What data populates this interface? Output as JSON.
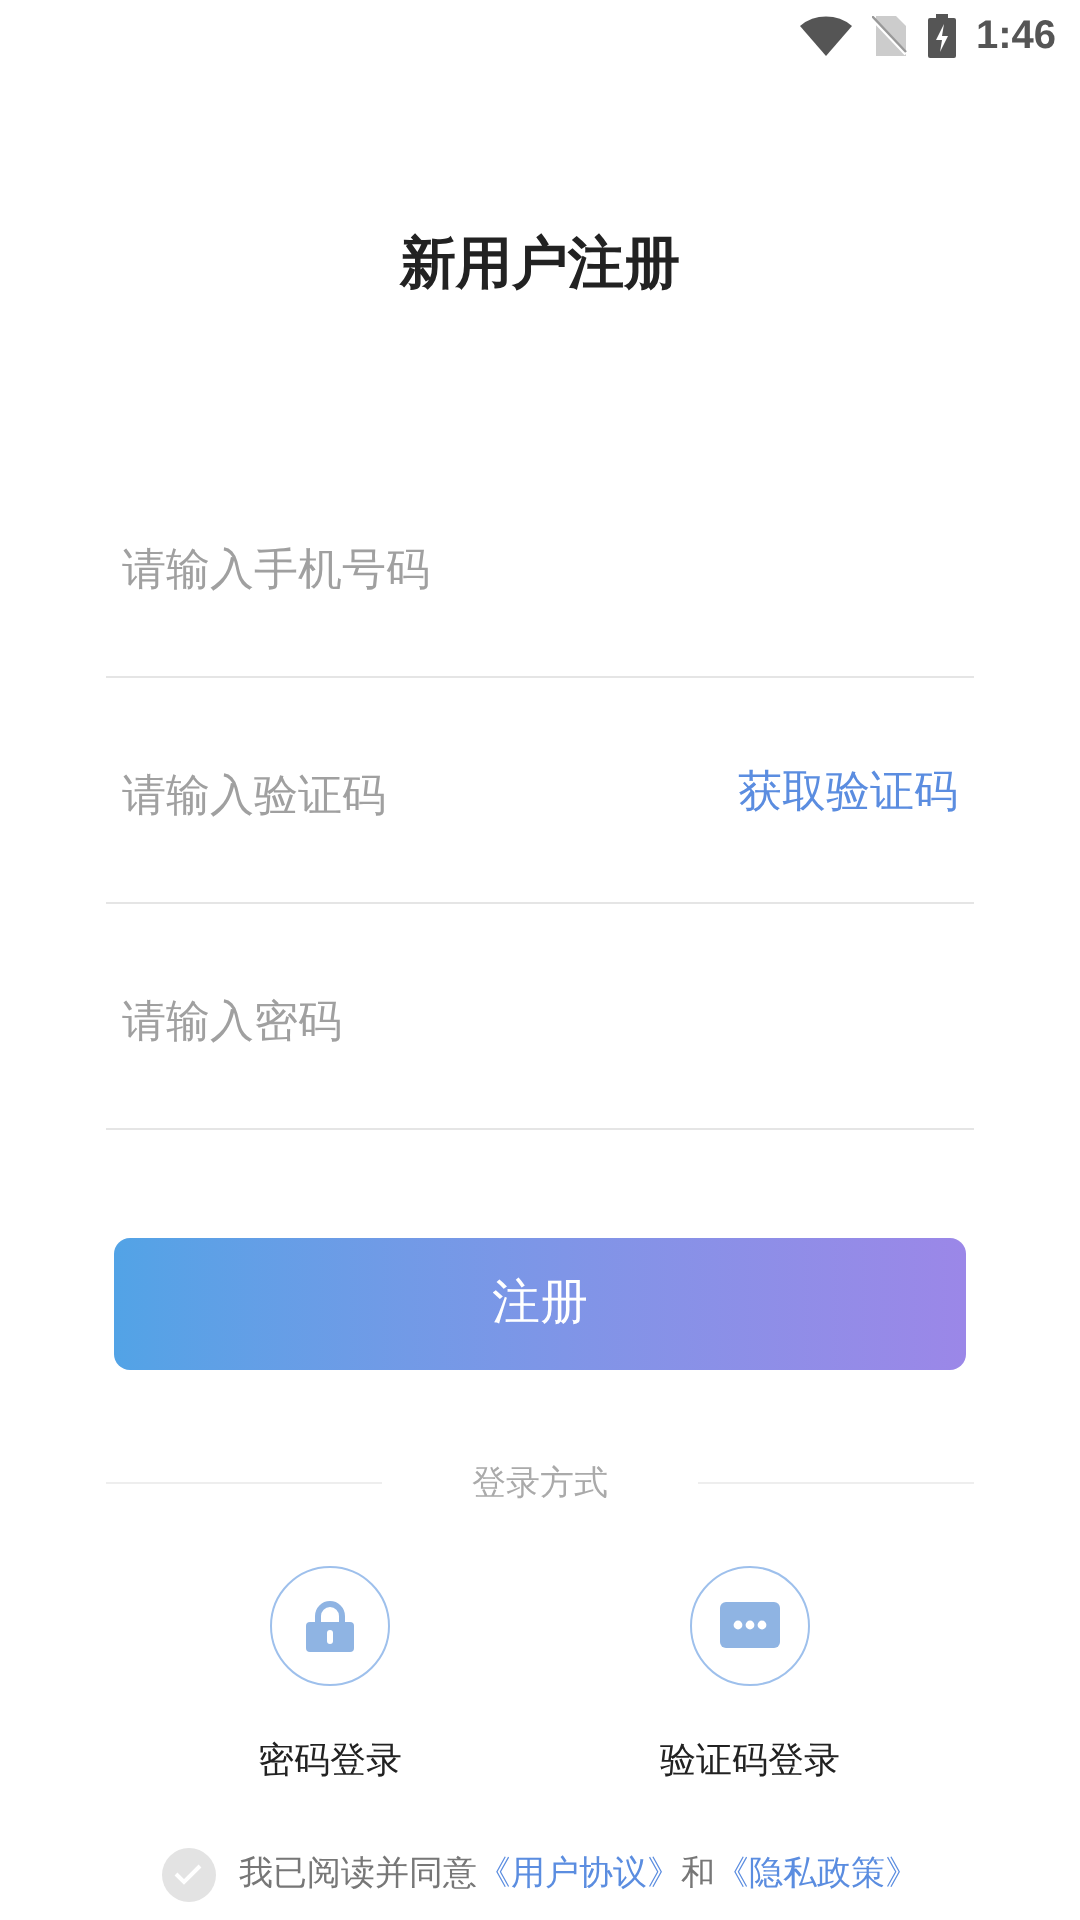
{
  "status_bar": {
    "time": "1:46"
  },
  "title": "新用户注册",
  "fields": [
    {
      "placeholder": "请输入手机号码"
    },
    {
      "placeholder": "请输入验证码",
      "action": "获取验证码"
    },
    {
      "placeholder": "请输入密码"
    }
  ],
  "submit": "注册",
  "login_methods": {
    "heading": "登录方式",
    "items": [
      {
        "kind": "password",
        "label": "密码登录"
      },
      {
        "kind": "sms",
        "label": "验证码登录"
      }
    ]
  },
  "agreement": {
    "checked": false,
    "prefix": "我已阅读并同意",
    "links": [
      "《用户协议》",
      "《隐私政策》"
    ],
    "joiner": "和"
  }
}
